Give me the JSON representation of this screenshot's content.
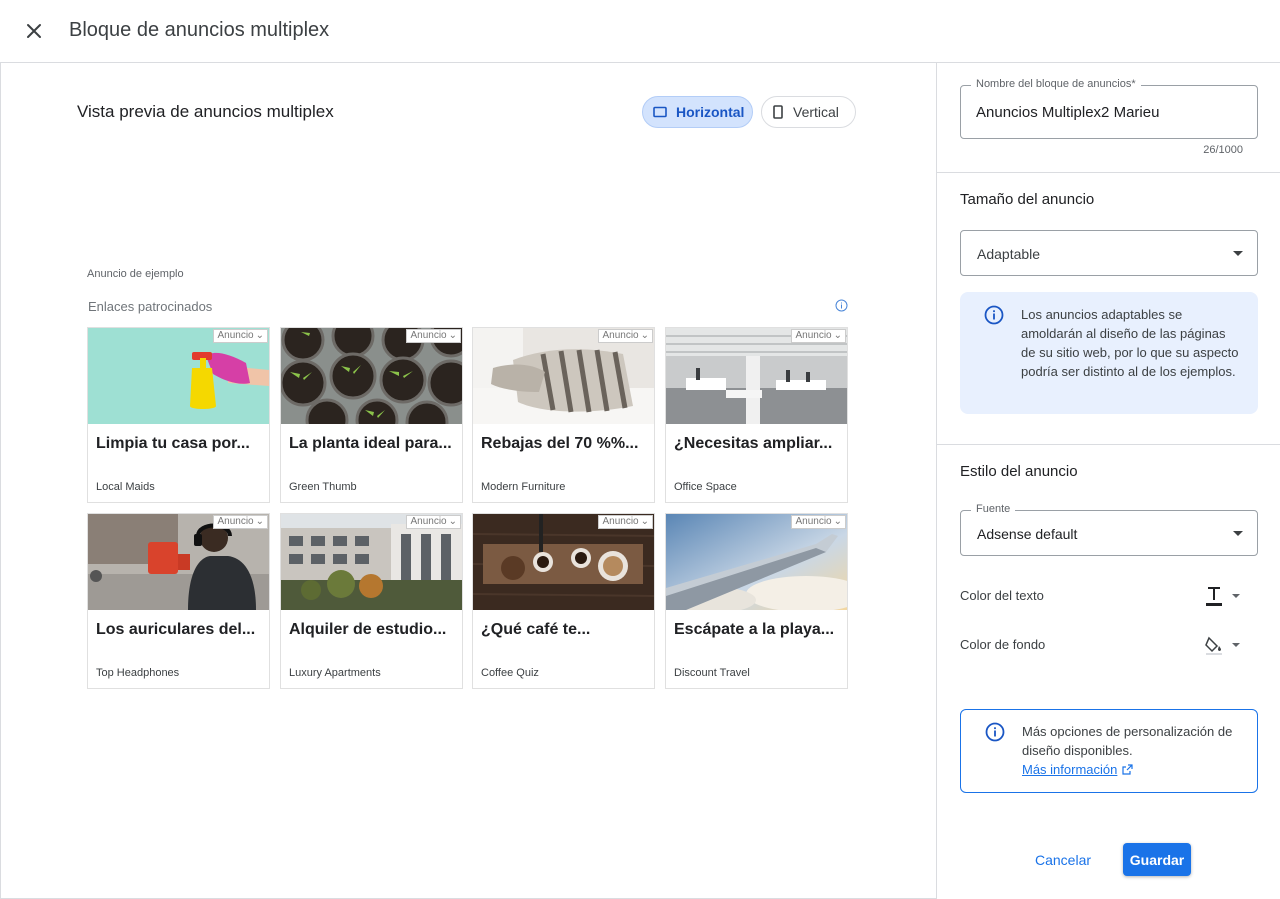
{
  "header": {
    "title": "Bloque de anuncios multiplex",
    "close_icon": "close-icon"
  },
  "preview": {
    "title": "Vista previa de anuncios multiplex",
    "toggle_horizontal": "Horizontal",
    "toggle_vertical": "Vertical",
    "selected_orientation": "Horizontal",
    "sample_label": "Anuncio de ejemplo",
    "sponsored_label": "Enlaces patrocinados",
    "badge_label": "Anuncio",
    "cards": [
      {
        "headline": "Limpia tu casa por...",
        "advertiser": "Local Maids",
        "image": "spray-bottle-image"
      },
      {
        "headline": "La planta ideal para...",
        "advertiser": "Green Thumb",
        "image": "seedling-pots-image"
      },
      {
        "headline": "Rebajas del 70 %%...",
        "advertiser": "Modern Furniture",
        "image": "bedroom-pillows-image"
      },
      {
        "headline": "¿Necesitas ampliar...",
        "advertiser": "Office Space",
        "image": "office-interior-image"
      },
      {
        "headline": "Los auriculares del...",
        "advertiser": "Top Headphones",
        "image": "street-headphones-image"
      },
      {
        "headline": "Alquiler de estudio...",
        "advertiser": "Luxury Apartments",
        "image": "apartment-building-image"
      },
      {
        "headline": "¿Qué café te...",
        "advertiser": "Coffee Quiz",
        "image": "coffee-table-image"
      },
      {
        "headline": "Escápate a la playa...",
        "advertiser": "Discount Travel",
        "image": "airplane-wing-image"
      }
    ]
  },
  "panel": {
    "name_label": "Nombre del bloque de anuncios*",
    "name_value": "Anuncios Multiplex2 Marieu",
    "name_counter": "26/1000",
    "size_title": "Tamaño del anuncio",
    "size_value": "Adaptable",
    "size_info": "Los anuncios adaptables se amoldarán al diseño de las páginas de su sitio web, por lo que su aspecto podría ser distinto al de los ejemplos.",
    "style_title": "Estilo del anuncio",
    "font_label": "Fuente",
    "font_value": "Adsense default",
    "text_color_label": "Color del texto",
    "bg_color_label": "Color de fondo",
    "more_text": "Más opciones de personalización de diseño disponibles.",
    "more_link": "Más información",
    "cancel_label": "Cancelar",
    "save_label": "Guardar"
  },
  "colors": {
    "accent": "#1a73e8",
    "toggle_active_bg": "#d3e3fd",
    "info_bg": "#e8f0fe"
  }
}
